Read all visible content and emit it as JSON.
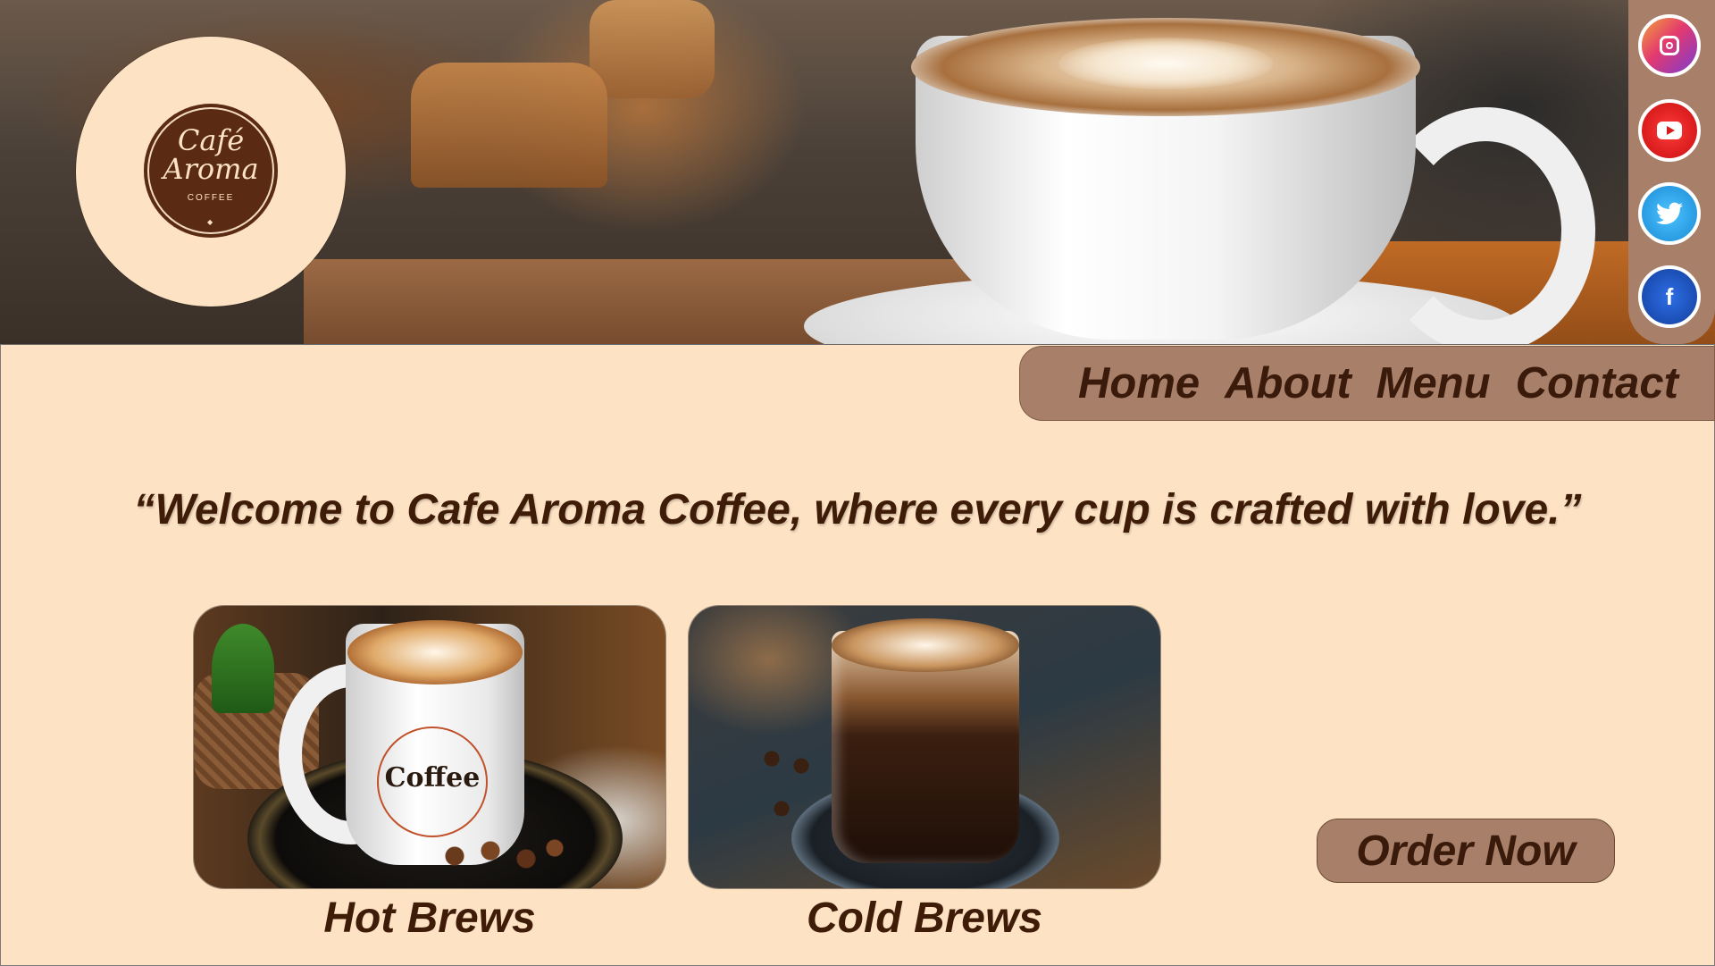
{
  "brand": {
    "logo_line1": "Café",
    "logo_line2": "Aroma",
    "logo_tagline": "COFFEE"
  },
  "social": [
    {
      "name": "instagram",
      "icon": "instagram-icon"
    },
    {
      "name": "youtube",
      "icon": "youtube-icon"
    },
    {
      "name": "twitter",
      "icon": "twitter-icon"
    },
    {
      "name": "facebook",
      "icon": "facebook-icon"
    }
  ],
  "nav": {
    "home": "Home",
    "about": "About",
    "menu": "Menu",
    "contact": "Contact"
  },
  "welcome": "“Welcome to Cafe Aroma Coffee, where every cup is crafted with love.”",
  "products": {
    "hot": {
      "caption": "Hot Brews",
      "mug_text": "Coffee"
    },
    "cold": {
      "caption": "Cold Brews"
    }
  },
  "cta": {
    "order": "Order Now"
  },
  "colors": {
    "background": "#fde3c4",
    "accent": "#a8806a",
    "text_dark": "#3f1c08"
  }
}
